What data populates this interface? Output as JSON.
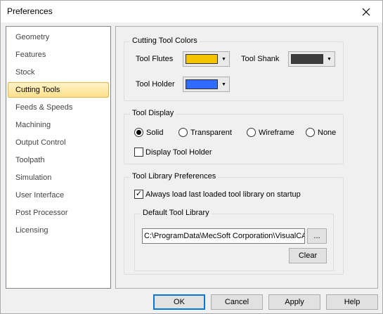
{
  "window": {
    "title": "Preferences"
  },
  "nav": {
    "items": [
      {
        "label": "Geometry"
      },
      {
        "label": "Features"
      },
      {
        "label": "Stock"
      },
      {
        "label": "Cutting Tools",
        "selected": true
      },
      {
        "label": "Feeds & Speeds"
      },
      {
        "label": "Machining"
      },
      {
        "label": "Output Control"
      },
      {
        "label": "Toolpath"
      },
      {
        "label": "Simulation"
      },
      {
        "label": "User Interface"
      },
      {
        "label": "Post Processor"
      },
      {
        "label": "Licensing"
      }
    ]
  },
  "colors_group": {
    "title": "Cutting Tool Colors",
    "flutes_label": "Tool Flutes",
    "flutes_color": "#f5c400",
    "shank_label": "Tool Shank",
    "shank_color": "#3d3d3d",
    "holder_label": "Tool Holder",
    "holder_color": "#2f6bff"
  },
  "display_group": {
    "title": "Tool Display",
    "options": [
      "Solid",
      "Transparent",
      "Wireframe",
      "None"
    ],
    "selected": "Solid",
    "holder_checkbox_label": "Display Tool Holder",
    "holder_checked": false
  },
  "library_group": {
    "title": "Tool Library Preferences",
    "always_load_label": "Always load last loaded tool library on startup",
    "always_load_checked": true,
    "default_title": "Default Tool Library",
    "path_value": "C:\\ProgramData\\MecSoft Corporation\\VisualCA",
    "browse_label": "...",
    "clear_label": "Clear"
  },
  "footer": {
    "ok": "OK",
    "cancel": "Cancel",
    "apply": "Apply",
    "help": "Help"
  },
  "icons": {
    "close": "close-icon",
    "dropdown": "chevron-down-icon"
  }
}
